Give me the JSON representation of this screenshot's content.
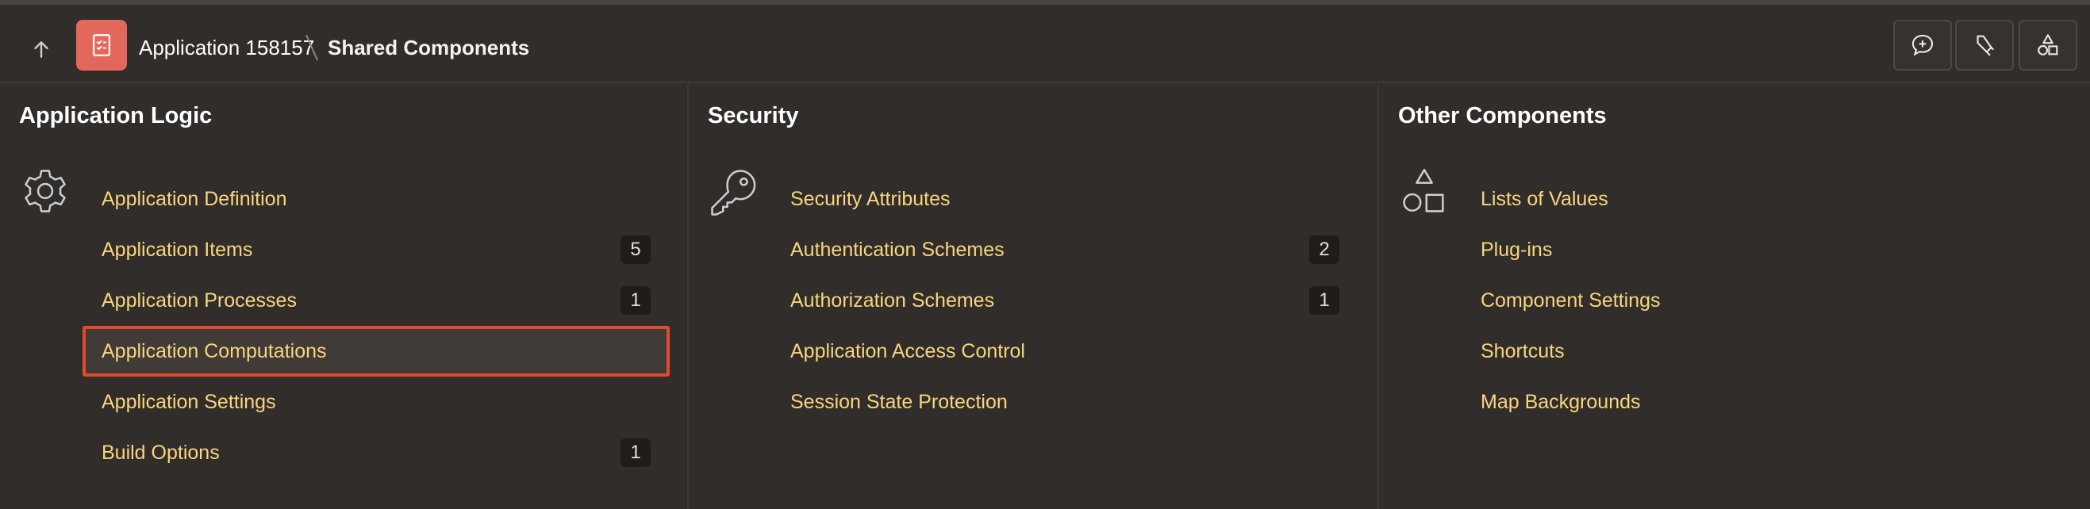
{
  "header": {
    "app_name": "Application 158157",
    "current_page": "Shared Components"
  },
  "columns": [
    {
      "title": "Application Logic",
      "icon": "gear-icon",
      "items": [
        {
          "label": "Application Definition",
          "badge": ""
        },
        {
          "label": "Application Items",
          "badge": "5"
        },
        {
          "label": "Application Processes",
          "badge": "1"
        },
        {
          "label": "Application Computations",
          "badge": "",
          "highlighted": true
        },
        {
          "label": "Application Settings",
          "badge": ""
        },
        {
          "label": "Build Options",
          "badge": "1"
        }
      ]
    },
    {
      "title": "Security",
      "icon": "key-icon",
      "items": [
        {
          "label": "Security Attributes",
          "badge": ""
        },
        {
          "label": "Authentication Schemes",
          "badge": "2"
        },
        {
          "label": "Authorization Schemes",
          "badge": "1"
        },
        {
          "label": "Application Access Control",
          "badge": ""
        },
        {
          "label": "Session State Protection",
          "badge": ""
        }
      ]
    },
    {
      "title": "Other Components",
      "icon": "shapes-icon",
      "items": [
        {
          "label": "Lists of Values",
          "badge": ""
        },
        {
          "label": "Plug-ins",
          "badge": ""
        },
        {
          "label": "Component Settings",
          "badge": ""
        },
        {
          "label": "Shortcuts",
          "badge": ""
        },
        {
          "label": "Map Backgrounds",
          "badge": ""
        }
      ]
    }
  ],
  "colors": {
    "link": "#f8d57e",
    "highlight_border": "#e04a2f",
    "app_icon_bg": "#e2685b"
  }
}
